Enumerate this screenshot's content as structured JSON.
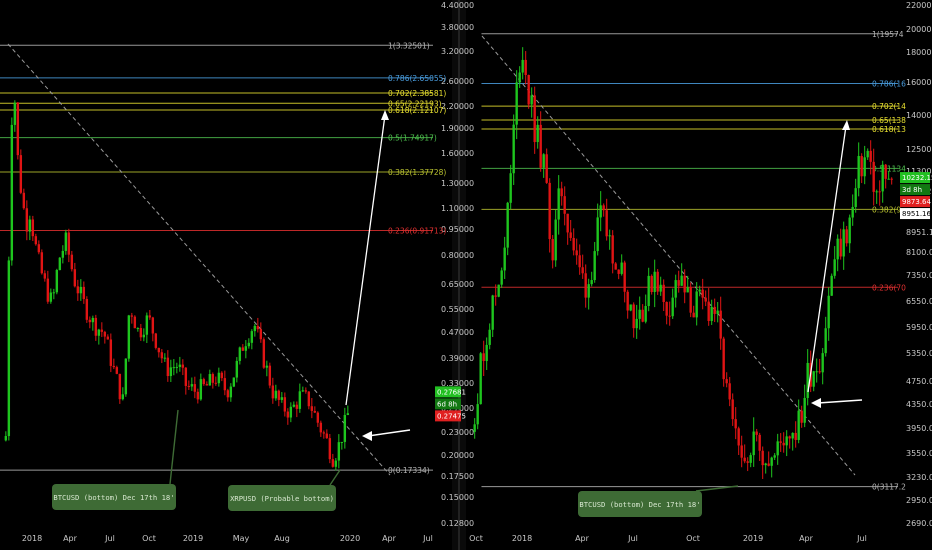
{
  "colors": {
    "background": "#000000",
    "up": "#1ec51e",
    "down": "#e01414",
    "axis_text": "#c8c8c8",
    "divider": "#3a3a3a",
    "annotation_bg": "#3e6b35",
    "annotation_text": "#d8e8d0",
    "arrow": "#ffffff",
    "trendline": "#9a9a9a"
  },
  "chart_data": [
    {
      "type": "line",
      "title": "",
      "y_scale": "log",
      "ylim": [
        0.12,
        4.4
      ],
      "x_ticks": [
        "2018",
        "Apr",
        "Jul",
        "Oct",
        "2019",
        "May",
        "Aug",
        "2020",
        "Apr",
        "Jul"
      ],
      "y_ticks": [
        "4.40000",
        "3.80000",
        "3.20000",
        "2.60000",
        "2.20000",
        "1.90000",
        "1.60000",
        "1.30000",
        "1.10000",
        "0.95000",
        "0.80000",
        "0.65000",
        "0.55000",
        "0.47000",
        "0.39000",
        "0.33000",
        "0.27000",
        "0.23000",
        "0.20000",
        "0.17500",
        "0.15000",
        "0.12800"
      ],
      "series": [
        {
          "x": [
            "2017-12-18",
            "2017-12-23",
            "2017-12-28",
            "2018-01-04",
            "2018-01-12",
            "2018-01-20",
            "2018-02-01",
            "2018-02-10",
            "2018-02-20",
            "2018-03-05",
            "2018-03-20",
            "2018-04-01",
            "2018-04-15",
            "2018-05-01",
            "2018-05-20",
            "2018-06-10",
            "2018-07-01",
            "2018-07-25",
            "2018-08-15",
            "2018-09-05",
            "2018-09-20",
            "2018-10-10",
            "2018-11-01",
            "2018-11-20",
            "2018-12-10",
            "2019-01-05",
            "2019-01-25",
            "2019-02-15",
            "2019-03-10",
            "2019-04-01",
            "2019-04-25",
            "2019-05-15",
            "2019-06-01",
            "2019-06-25",
            "2019-07-15",
            "2019-08-05",
            "2019-08-25",
            "2019-09-15",
            "2019-10-05",
            "2019-10-25",
            "2019-11-15",
            "2019-12-05",
            "2019-12-17",
            "2019-12-28",
            "2020-01-10",
            "2020-01-25"
          ],
          "y": [
            0.22,
            0.55,
            1.5,
            2.8,
            1.6,
            1.25,
            0.95,
            1.05,
            0.85,
            0.7,
            0.6,
            0.55,
            0.75,
            0.85,
            0.65,
            0.55,
            0.48,
            0.45,
            0.35,
            0.28,
            0.55,
            0.45,
            0.5,
            0.42,
            0.35,
            0.36,
            0.31,
            0.3,
            0.31,
            0.33,
            0.3,
            0.35,
            0.42,
            0.48,
            0.38,
            0.3,
            0.27,
            0.26,
            0.29,
            0.28,
            0.24,
            0.21,
            0.19,
            0.2,
            0.23,
            0.27
          ]
        }
      ],
      "fib_levels": [
        {
          "label": "1(3.32501)",
          "value": 3.32501,
          "color": "#b4b4b4"
        },
        {
          "label": "0.786(2.65055)",
          "value": 2.65055,
          "color": "#4a9ee0"
        },
        {
          "label": "0.702(2.38581)",
          "value": 2.38581,
          "color": "#e8e030"
        },
        {
          "label": "0.65(2.22193)",
          "value": 2.22193,
          "color": "#e8e030"
        },
        {
          "label": "0.618(2.12107)",
          "value": 2.12107,
          "color": "#e8e030"
        },
        {
          "label": "0.5(1.74917)",
          "value": 1.74917,
          "color": "#4ec04e"
        },
        {
          "label": "0.382(1.37728)",
          "value": 1.37728,
          "color": "#b8c030"
        },
        {
          "label": "0.236(0.91713)",
          "value": 0.91713,
          "color": "#e03030"
        },
        {
          "label": "0(0.17334)",
          "value": 0.17334,
          "color": "#b4b4b4"
        }
      ],
      "price_badges": [
        {
          "label": "0.27681",
          "color": "#22c022"
        },
        {
          "label": "6d 8h",
          "color": "#127812"
        },
        {
          "label": "0.27475",
          "color": "#e02020"
        }
      ],
      "annotations": [
        "BTCUSD (bottom) Dec 17th 18'",
        "XRPUSD (Probable bottom)"
      ]
    },
    {
      "type": "line",
      "title": "",
      "y_scale": "log",
      "ylim": [
        2690,
        22000
      ],
      "x_ticks": [
        "Oct",
        "2018",
        "Apr",
        "Jul",
        "Oct",
        "2019",
        "Apr",
        "Jul"
      ],
      "y_ticks": [
        "22000.00",
        "20000.00",
        "18000.00",
        "16000.00",
        "14000.00",
        "12500.00",
        "11300.00",
        "10232.15",
        "8951.16",
        "8100.00",
        "7350.00",
        "6550.00",
        "5950.00",
        "5350.00",
        "4750.00",
        "4350.00",
        "3950.00",
        "3550.00",
        "3230.00",
        "2950.00",
        "2690.00"
      ],
      "series": [
        {
          "x": [
            "2017-10-01",
            "2017-10-20",
            "2017-11-10",
            "2017-11-25",
            "2017-12-08",
            "2017-12-17",
            "2017-12-28",
            "2018-01-10",
            "2018-01-25",
            "2018-02-06",
            "2018-02-20",
            "2018-03-05",
            "2018-03-20",
            "2018-04-05",
            "2018-04-25",
            "2018-05-10",
            "2018-05-30",
            "2018-06-20",
            "2018-07-10",
            "2018-07-25",
            "2018-08-10",
            "2018-09-01",
            "2018-09-20",
            "2018-10-10",
            "2018-11-01",
            "2018-11-20",
            "2018-12-05",
            "2018-12-15",
            "2018-12-28",
            "2019-01-15",
            "2019-02-05",
            "2019-02-25",
            "2019-03-20",
            "2019-04-02",
            "2019-04-25",
            "2019-05-15",
            "2019-06-01",
            "2019-06-15",
            "2019-06-26",
            "2019-07-10",
            "2019-07-25",
            "2019-08-05",
            "2019-08-20"
          ],
          "y": [
            4300,
            5800,
            7200,
            9500,
            15000,
            19000,
            15500,
            13000,
            11000,
            8000,
            10500,
            9000,
            7500,
            7000,
            9200,
            8600,
            7500,
            6200,
            6600,
            7600,
            6300,
            7200,
            6500,
            6500,
            6400,
            4500,
            3700,
            3300,
            3800,
            3650,
            3450,
            3900,
            4000,
            4900,
            5300,
            7800,
            8500,
            9500,
            11300,
            12000,
            10000,
            11000,
            10300
          ]
        }
      ],
      "fib_levels": [
        {
          "label": "1(19574",
          "value": 19574,
          "color": "#b4b4b4"
        },
        {
          "label": "0.786(16",
          "value": 16000,
          "color": "#4a9ee0"
        },
        {
          "label": "0.702(14",
          "value": 14600,
          "color": "#e8e030"
        },
        {
          "label": "0.65(138",
          "value": 13800,
          "color": "#e8e030"
        },
        {
          "label": "0.618(13",
          "value": 13300,
          "color": "#e8e030"
        },
        {
          "label": "0.5(1134",
          "value": 11340,
          "color": "#4ec04e"
        },
        {
          "label": "0.382(9",
          "value": 9600,
          "color": "#b8c030"
        },
        {
          "label": "0.236(70",
          "value": 7000,
          "color": "#e03030"
        },
        {
          "label": "0(3117.2",
          "value": 3117.2,
          "color": "#b4b4b4"
        }
      ],
      "price_badges": [
        {
          "label": "10232.15",
          "color": "#22c022"
        },
        {
          "label": "3d 8h",
          "color": "#127812"
        },
        {
          "label": "9873.64",
          "color": "#e02020"
        },
        {
          "label": "8951.16",
          "color": "#ffffff"
        }
      ],
      "annotations": [
        "BTCUSD (bottom) Dec 17th 18'"
      ]
    }
  ]
}
